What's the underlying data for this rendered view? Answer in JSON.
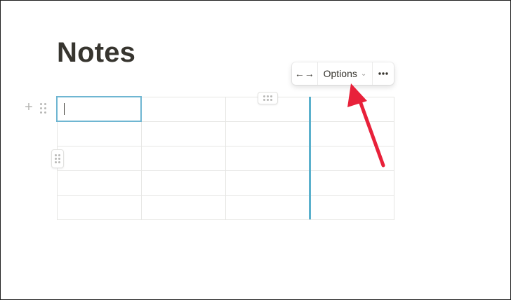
{
  "page": {
    "title": "Notes"
  },
  "table": {
    "rows": 5,
    "cols": 4
  },
  "toolbar": {
    "width_icon": "arrows-horizontal-icon",
    "width_glyph": "←→",
    "options_label": "Options",
    "options_chevron": "⌄",
    "more_glyph": "•••"
  },
  "side": {
    "plus_glyph": "+"
  },
  "colors": {
    "accent": "#5ab0cc",
    "annotation_arrow": "#e8213a",
    "text": "#37352f"
  }
}
